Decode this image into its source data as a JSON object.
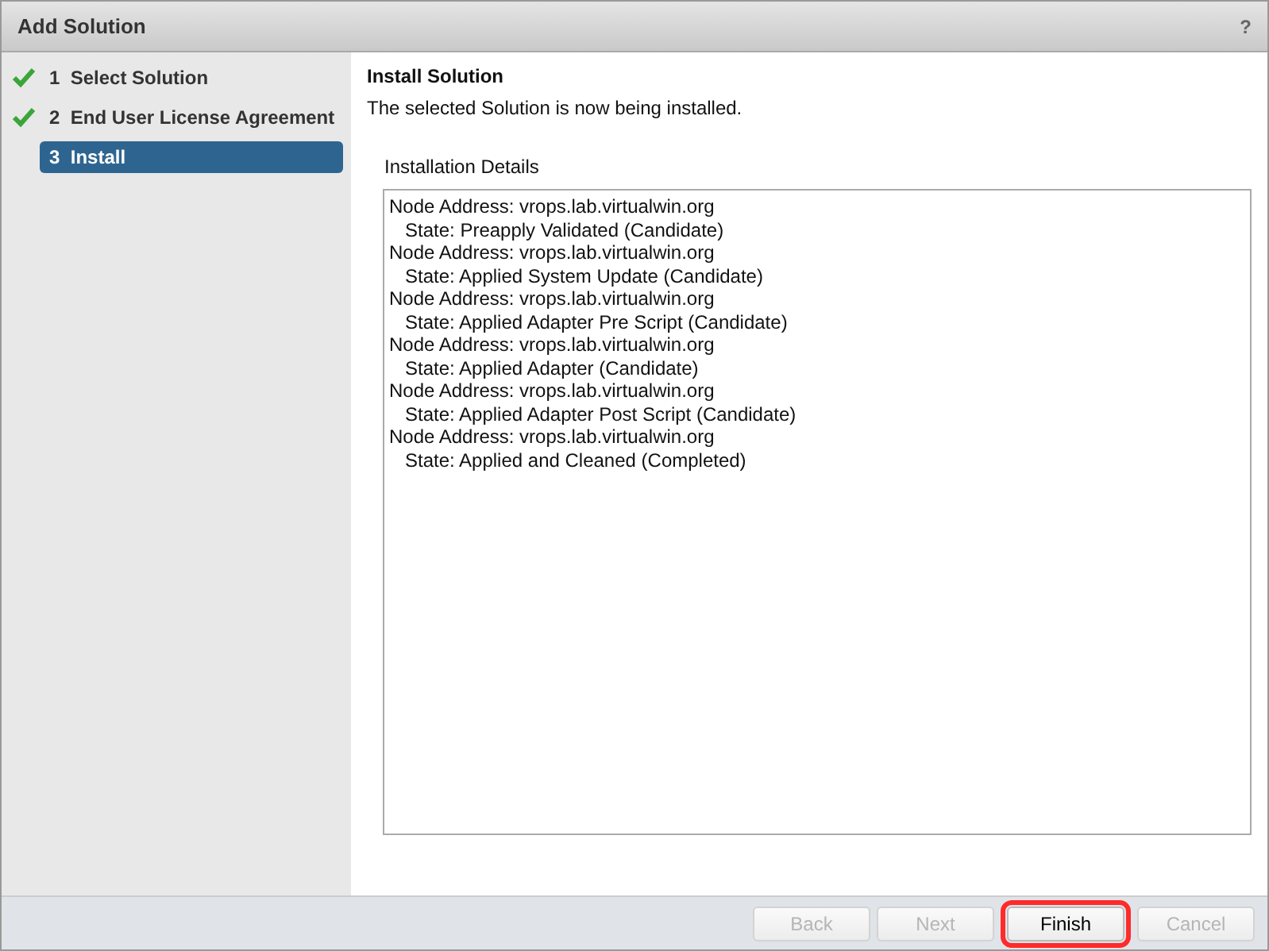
{
  "window": {
    "title": "Add Solution",
    "help": "?"
  },
  "steps": [
    {
      "number": "1",
      "label": "Select Solution",
      "completed": true,
      "selected": false
    },
    {
      "number": "2",
      "label": "End User License Agreement",
      "completed": true,
      "selected": false
    },
    {
      "number": "3",
      "label": "Install",
      "completed": false,
      "selected": true
    }
  ],
  "content": {
    "heading": "Install Solution",
    "description": "The selected Solution is now being installed.",
    "details_label": "Installation Details",
    "details": [
      {
        "node": "Node Address: vrops.lab.virtualwin.org",
        "state": "State: Preapply Validated (Candidate)"
      },
      {
        "node": "Node Address: vrops.lab.virtualwin.org",
        "state": "State: Applied System Update (Candidate)"
      },
      {
        "node": "Node Address: vrops.lab.virtualwin.org",
        "state": "State: Applied Adapter Pre Script (Candidate)"
      },
      {
        "node": "Node Address: vrops.lab.virtualwin.org",
        "state": "State: Applied Adapter (Candidate)"
      },
      {
        "node": "Node Address: vrops.lab.virtualwin.org",
        "state": "State: Applied Adapter Post Script (Candidate)"
      },
      {
        "node": "Node Address: vrops.lab.virtualwin.org",
        "state": "State: Applied and Cleaned (Completed)"
      }
    ]
  },
  "buttons": [
    {
      "label": "Back",
      "disabled": true,
      "highlighted": false
    },
    {
      "label": "Next",
      "disabled": true,
      "highlighted": false
    },
    {
      "label": "Finish",
      "disabled": false,
      "highlighted": true
    },
    {
      "label": "Cancel",
      "disabled": true,
      "highlighted": false
    }
  ]
}
